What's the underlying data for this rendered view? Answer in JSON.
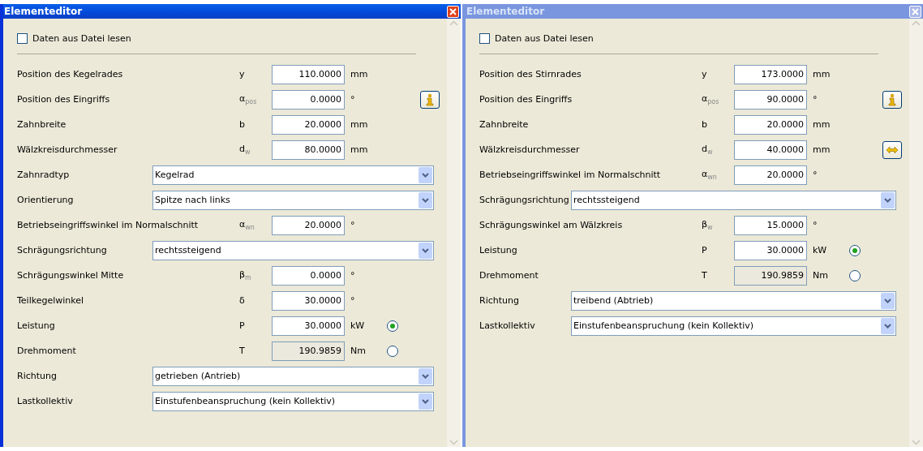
{
  "windows": [
    {
      "title": "Elementeditor",
      "active": true,
      "read_from_file": {
        "label": "Daten aus Datei lesen",
        "checked": false
      },
      "rows": [
        {
          "kind": "number",
          "label": "Position des Kegelrades",
          "symbol": "y",
          "value": "110.0000",
          "unit": "mm",
          "readonly": false
        },
        {
          "kind": "number",
          "label": "Position des Eingriffs",
          "symbol": "α$_{pos}$",
          "value": "0.0000",
          "unit": "°",
          "readonly": false,
          "side_button": {
            "kind": "info"
          }
        },
        {
          "kind": "number",
          "label": "Zahnbreite",
          "symbol": "b",
          "value": "20.0000",
          "unit": "mm",
          "readonly": false
        },
        {
          "kind": "number",
          "label": "Wälzkreisdurchmesser",
          "symbol": "d$_{w}$",
          "value": "80.0000",
          "unit": "mm",
          "readonly": false
        },
        {
          "kind": "combo",
          "label": "Zahnradtyp",
          "value": "Kegelrad"
        },
        {
          "kind": "combo",
          "label": "Orientierung",
          "value": "Spitze nach links"
        },
        {
          "kind": "number",
          "label": "Betriebseingriffswinkel im Normalschnitt",
          "symbol": "α$_{wn}$",
          "value": "20.0000",
          "unit": "°",
          "readonly": false
        },
        {
          "kind": "combo",
          "label": "Schrägungsrichtung",
          "value": "rechtssteigend"
        },
        {
          "kind": "number",
          "label": "Schrägungswinkel Mitte",
          "symbol": "β$_{m}$",
          "value": "0.0000",
          "unit": "°",
          "readonly": false
        },
        {
          "kind": "number",
          "label": "Teilkegelwinkel",
          "symbol": "δ",
          "value": "30.0000",
          "unit": "°",
          "readonly": false
        },
        {
          "kind": "number",
          "label": "Leistung",
          "symbol": "P",
          "value": "30.0000",
          "unit": "kW",
          "readonly": false,
          "radio": {
            "selected": true
          }
        },
        {
          "kind": "number",
          "label": "Drehmoment",
          "symbol": "T",
          "value": "190.9859",
          "unit": "Nm",
          "readonly": true,
          "radio": {
            "selected": false
          }
        },
        {
          "kind": "combo",
          "label": "Richtung",
          "value": "getrieben (Antrieb)"
        },
        {
          "kind": "combo",
          "label": "Lastkollektiv",
          "value": "Einstufenbeanspruchung (kein Kollektiv)"
        }
      ]
    },
    {
      "title": "Elementeditor",
      "active": false,
      "read_from_file": {
        "label": "Daten aus Datei lesen",
        "checked": false
      },
      "rows": [
        {
          "kind": "number",
          "label": "Position des Stirnrades",
          "symbol": "y",
          "value": "173.0000",
          "unit": "mm",
          "readonly": false
        },
        {
          "kind": "number",
          "label": "Position des Eingriffs",
          "symbol": "α$_{pos}$",
          "value": "90.0000",
          "unit": "°",
          "readonly": false,
          "side_button": {
            "kind": "info"
          }
        },
        {
          "kind": "number",
          "label": "Zahnbreite",
          "symbol": "b",
          "value": "20.0000",
          "unit": "mm",
          "readonly": false
        },
        {
          "kind": "number",
          "label": "Wälzkreisdurchmesser",
          "symbol": "d$_{w}$",
          "value": "40.0000",
          "unit": "mm",
          "readonly": false,
          "side_button": {
            "kind": "swap"
          }
        },
        {
          "kind": "number",
          "label": "Betriebseingriffswinkel im Normalschnitt",
          "symbol": "α$_{wn}$",
          "value": "20.0000",
          "unit": "°",
          "readonly": false
        },
        {
          "kind": "combo",
          "label": "Schrägungsrichtung",
          "value": "rechtssteigend"
        },
        {
          "kind": "number",
          "label": "Schrägungswinkel am Wälzkreis",
          "symbol": "β$_{w}$",
          "value": "15.0000",
          "unit": "°",
          "readonly": false
        },
        {
          "kind": "number",
          "label": "Leistung",
          "symbol": "P",
          "value": "30.0000",
          "unit": "kW",
          "readonly": false,
          "radio": {
            "selected": true
          }
        },
        {
          "kind": "number",
          "label": "Drehmoment",
          "symbol": "T",
          "value": "190.9859",
          "unit": "Nm",
          "readonly": true,
          "radio": {
            "selected": false
          }
        },
        {
          "kind": "combo",
          "label": "Richtung",
          "value": "treibend (Abtrieb)"
        },
        {
          "kind": "combo",
          "label": "Lastkollektiv",
          "value": "Einstufenbeanspruchung (kein Kollektiv)"
        }
      ]
    }
  ]
}
